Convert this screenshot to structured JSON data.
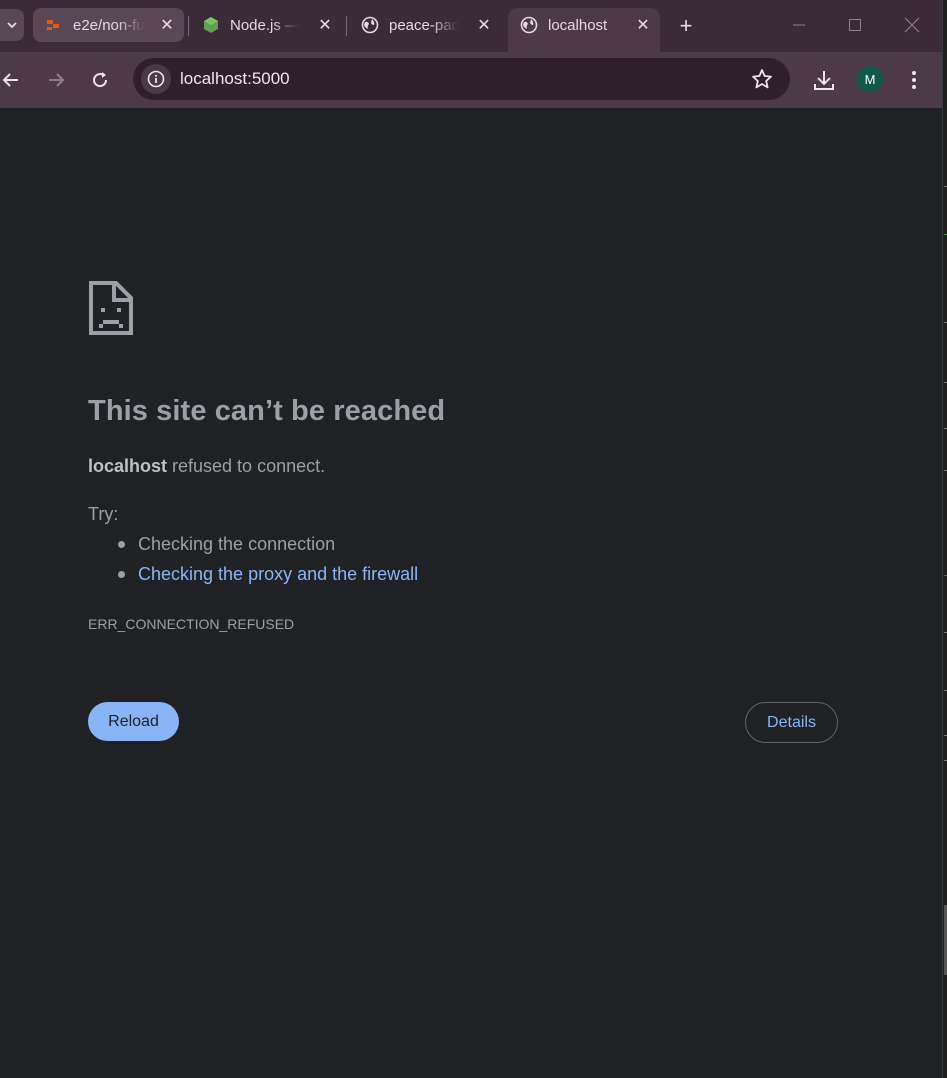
{
  "browser": {
    "tabs": [
      {
        "title": "e2e/non-fu",
        "favicon": "gitlab-orange-icon",
        "active": false
      },
      {
        "title": "Node.js — ",
        "favicon": "nodejs-green-hexagon-icon",
        "active": false
      },
      {
        "title": "peace-pad",
        "favicon": "globe-icon",
        "active": false
      },
      {
        "title": "localhost",
        "favicon": "globe-icon",
        "active": true
      }
    ],
    "new_tab_icon": "+",
    "address": "localhost:5000",
    "profile_initial": "M",
    "colors": {
      "tabstrip": "#3b2a38",
      "toolbar": "#4d3a49",
      "omnibox": "#2f1f2c",
      "avatar": "#0e5b47"
    }
  },
  "error_page": {
    "heading": "This site can’t be reached",
    "host": "localhost",
    "description_suffix": " refused to connect.",
    "try_label": "Try:",
    "suggestions": [
      "Checking the connection",
      "Checking the proxy and the firewall"
    ],
    "error_code": "ERR_CONNECTION_REFUSED",
    "reload_label": "Reload",
    "details_label": "Details",
    "colors": {
      "background": "#202124",
      "text": "#9aa0a6",
      "link": "#8ab4f8",
      "button": "#8ab4f8"
    }
  }
}
